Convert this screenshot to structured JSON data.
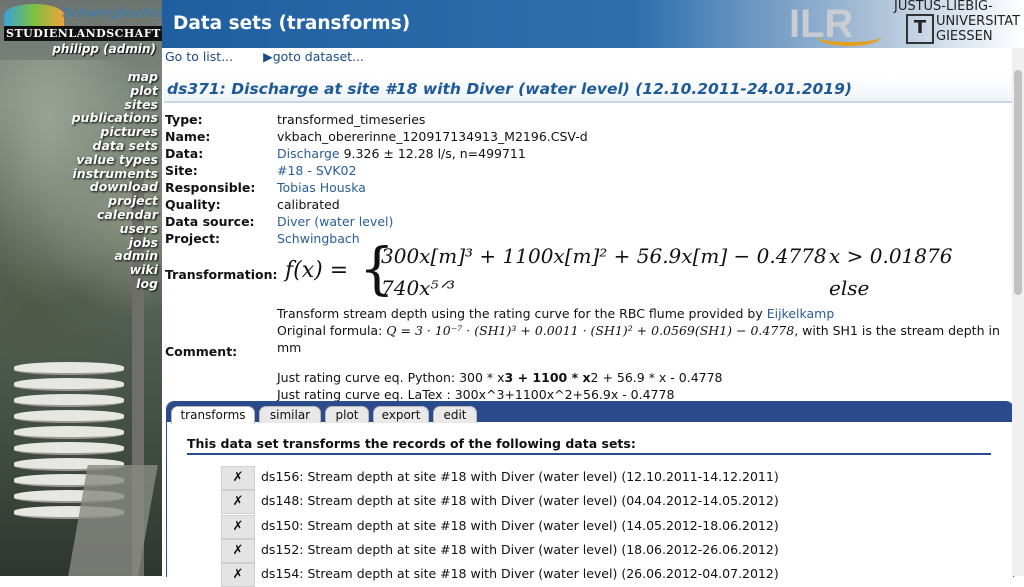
{
  "logo": {
    "top": "Schwingbachtal",
    "bottom": "STUDIENLANDSCHAFT"
  },
  "user": "philipp (admin)",
  "nav": [
    "map",
    "plot",
    "sites",
    "publications",
    "pictures",
    "data sets",
    "value types",
    "instruments",
    "download",
    "project",
    "calendar",
    "users",
    "jobs",
    "admin",
    "wiki",
    "log"
  ],
  "header": {
    "title": "Data sets (transforms)",
    "ilr": "ILR",
    "university": {
      "line1": "JUSTUS-LIEBIG-",
      "line2": "UNIVERSITAT",
      "line3": "GIESSEN",
      "mark": "T"
    }
  },
  "toplinks": {
    "list": "Go to list...",
    "goto": "▶goto dataset..."
  },
  "dataset_title": "ds371: Discharge at site #18 with Diver (water level) (12.10.2011-24.01.2019)",
  "props": {
    "type_label": "Type:",
    "type": "transformed_timeseries",
    "name_label": "Name:",
    "name": "vkbach_obererinne_120917134913_M2196.CSV-d",
    "data_label": "Data:",
    "data_link": "Discharge",
    "data_value": "9.326 ± 12.28 l/s, n=499711",
    "site_label": "Site:",
    "site": "#18 - SVK02",
    "responsible_label": "Responsible:",
    "responsible": "Tobias Houska",
    "quality_label": "Quality:",
    "quality": "calibrated",
    "source_label": "Data source:",
    "source": "Diver (water level)",
    "project_label": "Project:",
    "project": "Schwingbach",
    "transformation_label": "Transformation:",
    "comment_label": "Comment:"
  },
  "formula": {
    "fx": "f(x) =",
    "line1": "300x[m]³ + 1100x[m]² + 56.9x[m] − 0.4778",
    "line2": "740x⁵ᐟ³",
    "cond1": "x > 0.01876",
    "cond2": "else"
  },
  "comment": {
    "line1_pre": "Transform stream depth using the rating curve for the RBC flume provided by ",
    "line1_link": "Eijkelkamp",
    "line2_pre": "Original formula: ",
    "line2_formula": "Q = 3 · 10⁻⁷ · (SH1)³ + 0.0011 · (SH1)² + 0.0569(SH1) − 0.4778",
    "line2_post": ", with SH1 is the stream depth in mm",
    "line3_a": "Just rating curve eq. Python: 300 * x",
    "line3_b": "3 + 1100 * x",
    "line3_c": "2 + 56.9 * x - 0.4778",
    "line4": "Just rating curve eq. LaTex : 300x^3+1100x^2+56.9x - 0.4778"
  },
  "tabs": [
    "transforms",
    "similar",
    "plot",
    "export",
    "edit"
  ],
  "panel_heading": "This data set transforms the records of the following data sets:",
  "sources": [
    "ds156: Stream depth at site #18 with Diver (water level) (12.10.2011-14.12.2011)",
    "ds148: Stream depth at site #18 with Diver (water level) (04.04.2012-14.05.2012)",
    "ds150: Stream depth at site #18 with Diver (water level) (14.05.2012-18.06.2012)",
    "ds152: Stream depth at site #18 with Diver (water level) (18.06.2012-26.06.2012)",
    "ds154: Stream depth at site #18 with Diver (water level) (26.06.2012-04.07.2012)"
  ],
  "remove_glyph": "✗"
}
